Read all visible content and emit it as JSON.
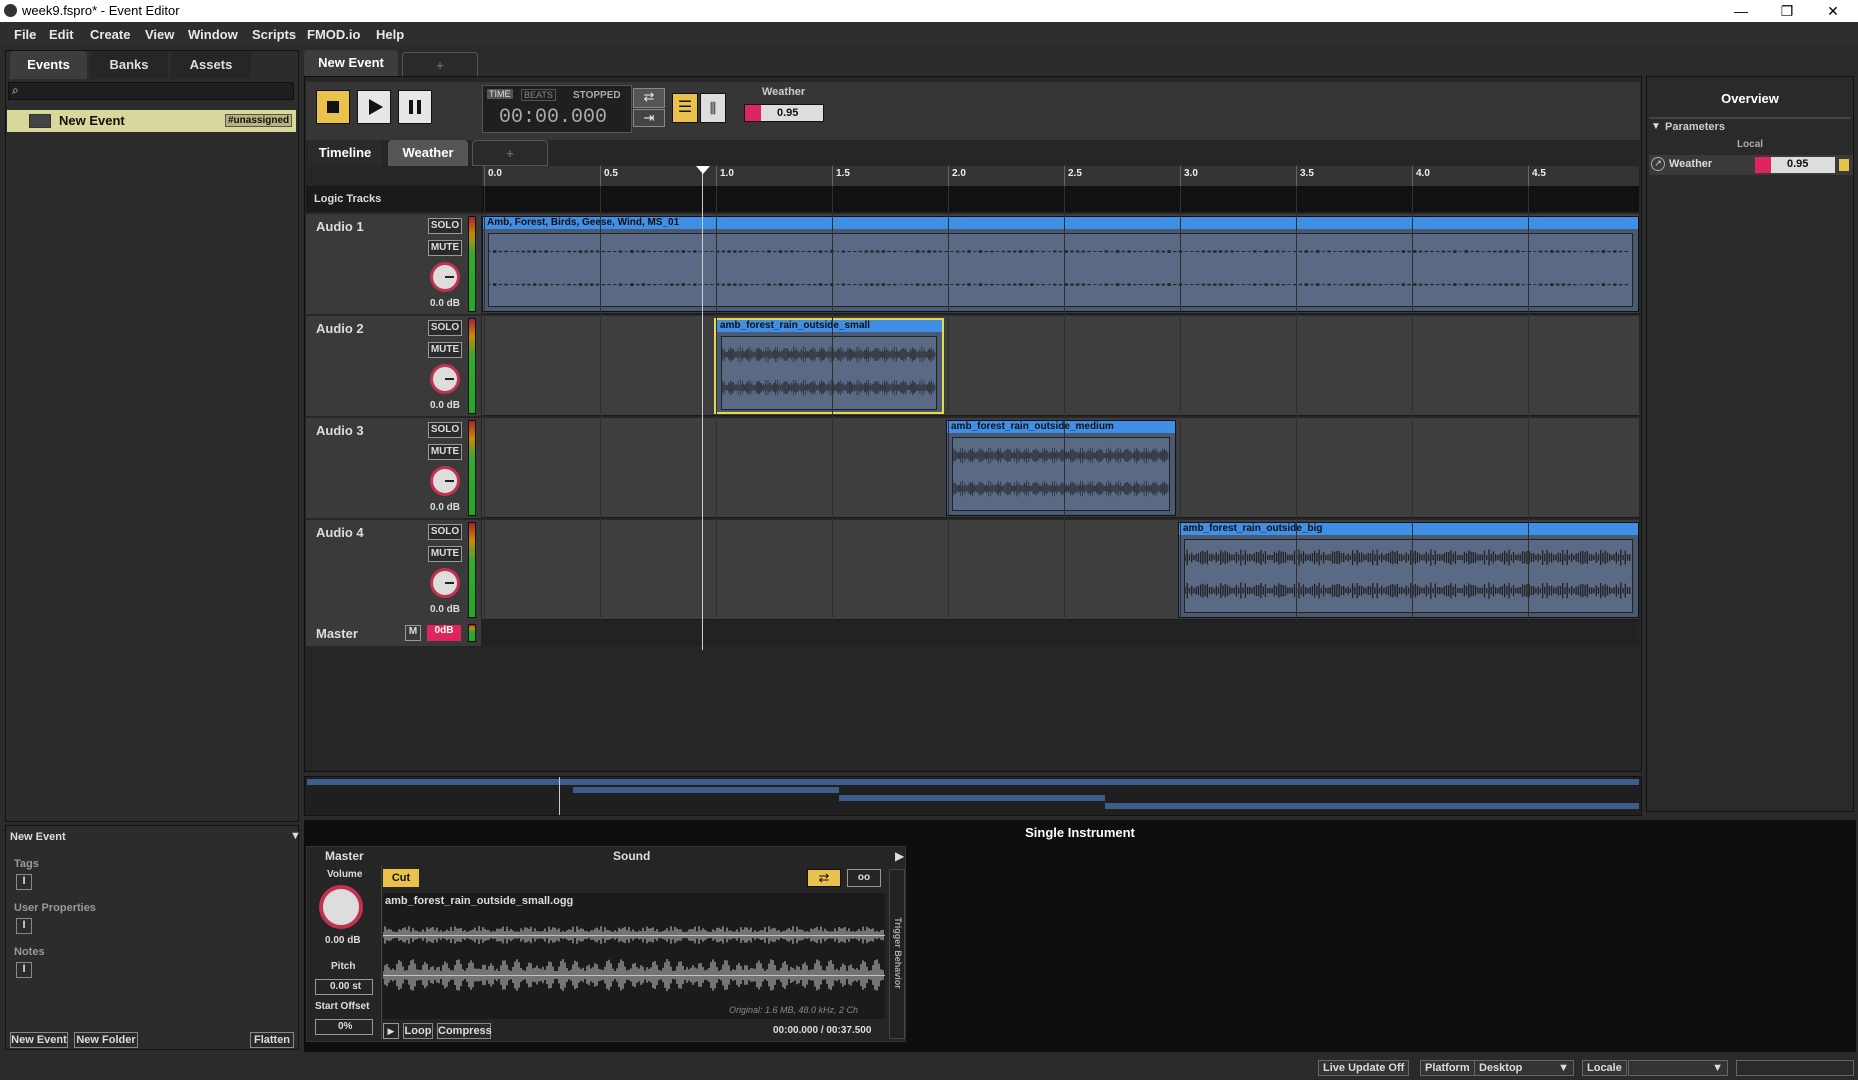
{
  "window": {
    "title": "week9.fspro* - Event Editor",
    "minimize": "—",
    "maximize": "❐",
    "close": "✕"
  },
  "menu": [
    "File",
    "Edit",
    "Create",
    "View",
    "Window",
    "Scripts",
    "FMOD.io",
    "Help"
  ],
  "browser": {
    "tabs": [
      "Events",
      "Banks",
      "Assets"
    ],
    "event_name": "New Event",
    "event_badge": "#unassigned"
  },
  "props": {
    "title": "New Event",
    "tags_label": "Tags",
    "user_props_label": "User Properties",
    "notes_label": "Notes",
    "new_event_btn": "New Event",
    "new_folder_btn": "New Folder",
    "flatten_btn": "Flatten"
  },
  "editor": {
    "event_tab": "New Event",
    "add_tab": "+",
    "time_label": "TIME",
    "beats_label": "BEATS",
    "state": "STOPPED",
    "time": "00:00.000",
    "param_name": "Weather",
    "param_value": "0.95",
    "subtabs": [
      "Timeline",
      "Weather",
      "+"
    ],
    "logic_tracks": "Logic Tracks",
    "ticks": [
      "0.0",
      "0.5",
      "1.0",
      "1.5",
      "2.0",
      "2.5",
      "3.0",
      "3.5",
      "4.0",
      "4.5"
    ]
  },
  "tracks": [
    {
      "name": "Audio 1",
      "solo": "SOLO",
      "mute": "MUTE",
      "db": "0.0 dB",
      "instrument": "Amb, Forest, Birds, Geese, Wind, MS_01"
    },
    {
      "name": "Audio 2",
      "solo": "SOLO",
      "mute": "MUTE",
      "db": "0.0 dB",
      "instrument": "amb_forest_rain_outside_small"
    },
    {
      "name": "Audio 3",
      "solo": "SOLO",
      "mute": "MUTE",
      "db": "0.0 dB",
      "instrument": "amb_forest_rain_outside_medium"
    },
    {
      "name": "Audio 4",
      "solo": "SOLO",
      "mute": "MUTE",
      "db": "0.0 dB",
      "instrument": "amb_forest_rain_outside_big"
    }
  ],
  "master": {
    "name": "Master",
    "m": "M",
    "db": "0dB"
  },
  "overview": {
    "title": "Overview",
    "parameters": "Parameters",
    "local": "Local",
    "param_name": "Weather",
    "param_value": "0.95"
  },
  "deck": {
    "title": "Single Instrument",
    "master_label": "Master",
    "sound_label": "Sound",
    "volume_label": "Volume",
    "volume_value": "0.00 dB",
    "pitch_label": "Pitch",
    "pitch_value": "0.00 st",
    "start_offset_label": "Start Offset",
    "start_offset_value": "0%",
    "cut_btn": "Cut",
    "loop_count": "oo",
    "file_name": "amb_forest_rain_outside_small.ogg",
    "file_info": "Original: 1.6 MB, 48.0 kHz, 2 Ch",
    "loop_btn": "Loop",
    "compress_btn": "Compress",
    "position": "00:00.000 / 00:37.500",
    "trigger_behavior": "Trigger Behavior"
  },
  "status": {
    "live_update": "Live Update Off",
    "platform_label": "Platform",
    "platform_value": "Desktop",
    "locale_label": "Locale",
    "locale_value": ""
  }
}
